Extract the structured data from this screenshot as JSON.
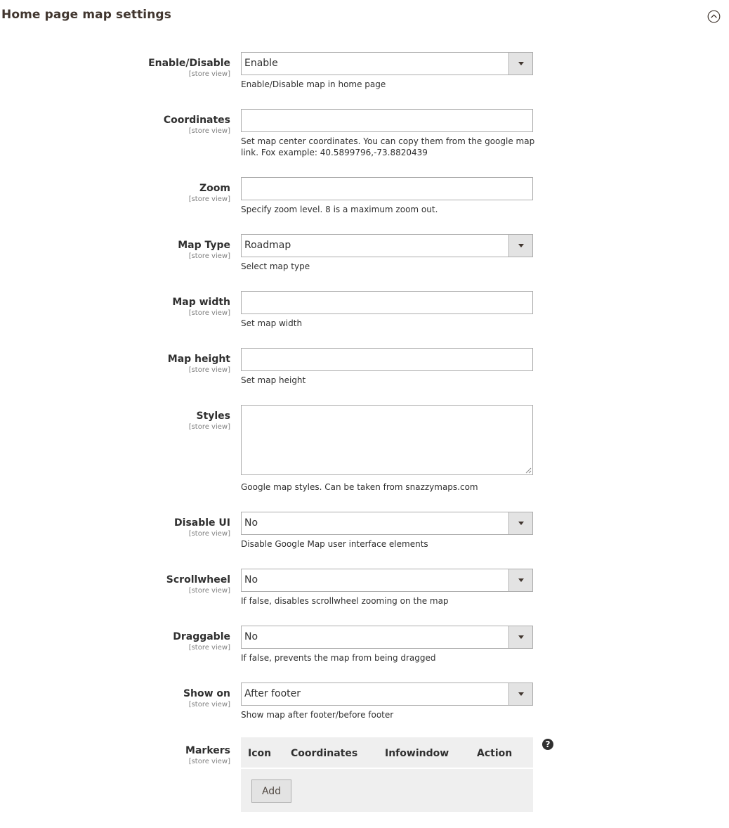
{
  "section": {
    "title": "Home page map settings"
  },
  "fields": [
    {
      "label": "Enable/Disable",
      "scope": "[store view]",
      "type": "select",
      "value": "Enable",
      "note": "Enable/Disable map in home page"
    },
    {
      "label": "Coordinates",
      "scope": "[store view]",
      "type": "text",
      "value": "",
      "note": "Set map center coordinates. You can copy them from the google map link. Fox example: 40.5899796,-73.8820439"
    },
    {
      "label": "Zoom",
      "scope": "[store view]",
      "type": "text",
      "value": "",
      "note": "Specify zoom level. 8 is a maximum zoom out."
    },
    {
      "label": "Map Type",
      "scope": "[store view]",
      "type": "select",
      "value": "Roadmap",
      "note": "Select map type"
    },
    {
      "label": "Map width",
      "scope": "[store view]",
      "type": "text",
      "value": "",
      "note": "Set map width"
    },
    {
      "label": "Map height",
      "scope": "[store view]",
      "type": "text",
      "value": "",
      "note": "Set map height"
    },
    {
      "label": "Styles",
      "scope": "[store view]",
      "type": "textarea",
      "value": "",
      "note": "Google map styles. Can be taken from snazzymaps.com"
    },
    {
      "label": "Disable UI",
      "scope": "[store view]",
      "type": "select",
      "value": "No",
      "note": "Disable Google Map user interface elements"
    },
    {
      "label": "Scrollwheel",
      "scope": "[store view]",
      "type": "select",
      "value": "No",
      "note": "If false, disables scrollwheel zooming on the map"
    },
    {
      "label": "Draggable",
      "scope": "[store view]",
      "type": "select",
      "value": "No",
      "note": "If false, prevents the map from being dragged"
    },
    {
      "label": "Show on",
      "scope": "[store view]",
      "type": "select",
      "value": "After footer",
      "note": "Show map after footer/before footer"
    }
  ],
  "markers": {
    "label": "Markers",
    "scope": "[store view]",
    "columns": [
      "Icon",
      "Coordinates",
      "Infowindow",
      "Action"
    ],
    "add_label": "Add",
    "help_glyph": "?"
  },
  "icons": {
    "collapse": "chevron-up-circle-icon",
    "select_arrow": "caret-down-icon",
    "help": "question-circle-icon",
    "resize": "resize-grip-icon"
  }
}
